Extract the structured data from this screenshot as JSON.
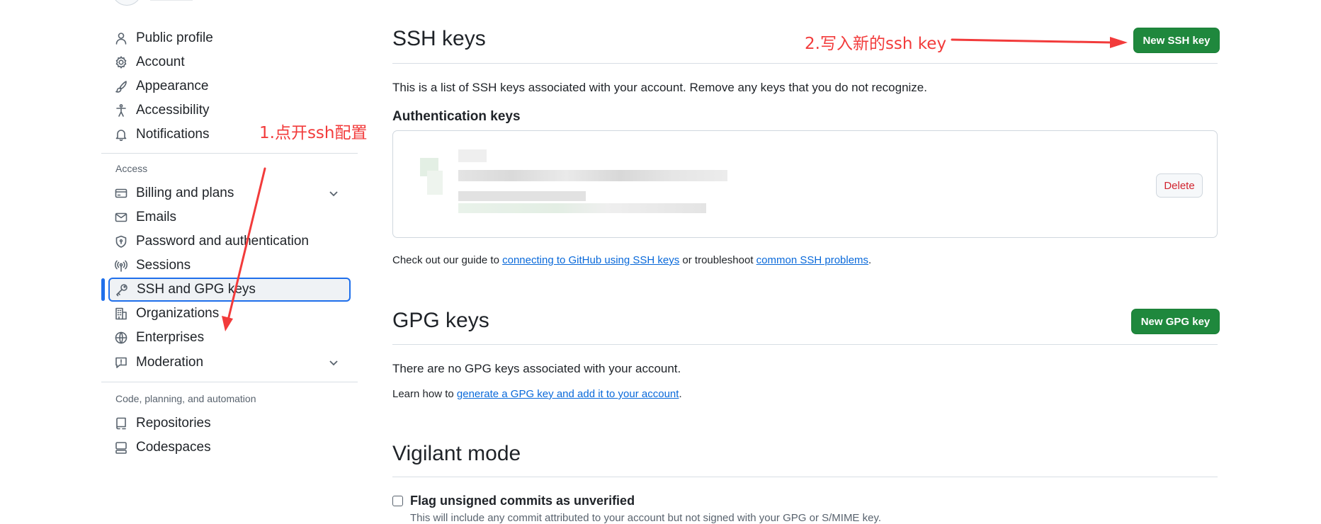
{
  "sidebar": {
    "items_top": [
      {
        "label": "Public profile",
        "icon": "person-icon"
      },
      {
        "label": "Account",
        "icon": "gear-icon"
      },
      {
        "label": "Appearance",
        "icon": "paintbrush-icon"
      },
      {
        "label": "Accessibility",
        "icon": "accessibility-icon"
      },
      {
        "label": "Notifications",
        "icon": "bell-icon"
      }
    ],
    "access_title": "Access",
    "items_access": [
      {
        "label": "Billing and plans",
        "icon": "credit-card-icon"
      },
      {
        "label": "Emails",
        "icon": "mail-icon"
      },
      {
        "label": "Password and authentication",
        "icon": "shield-lock-icon"
      },
      {
        "label": "Sessions",
        "icon": "broadcast-icon"
      },
      {
        "label": "SSH and GPG keys",
        "icon": "key-icon"
      },
      {
        "label": "Organizations",
        "icon": "organization-icon"
      },
      {
        "label": "Enterprises",
        "icon": "globe-icon"
      },
      {
        "label": "Moderation",
        "icon": "report-icon"
      }
    ],
    "code_title": "Code, planning, and automation",
    "items_code": [
      {
        "label": "Repositories",
        "icon": "repo-icon"
      },
      {
        "label": "Codespaces",
        "icon": "codespaces-icon"
      }
    ]
  },
  "ssh": {
    "title": "SSH keys",
    "new_button": "New SSH key",
    "description": "This is a list of SSH keys associated with your account. Remove any keys that you do not recognize.",
    "auth_title": "Authentication keys",
    "delete_button": "Delete",
    "guide_prefix": "Check out our guide to ",
    "guide_link1": "connecting to GitHub using SSH keys",
    "guide_mid": " or troubleshoot ",
    "guide_link2": "common SSH problems",
    "guide_suffix": "."
  },
  "gpg": {
    "title": "GPG keys",
    "new_button": "New GPG key",
    "empty_text": "There are no GPG keys associated with your account.",
    "learn_prefix": "Learn how to ",
    "learn_link": "generate a GPG key and add it to your account",
    "learn_suffix": "."
  },
  "vigilant": {
    "title": "Vigilant mode",
    "checkbox_label": "Flag unsigned commits as unverified",
    "checkbox_checked": false,
    "help_text": "This will include any commit attributed to your account but not signed with your GPG or S/MIME key."
  },
  "annotations": {
    "step1": "1.点开ssh配置",
    "step2": "2.写入新的ssh key"
  },
  "colors": {
    "accent_blue": "#1f6feb",
    "primary_green": "#1f883d",
    "danger_red": "#d1242f",
    "annotation_red": "#f23b3b",
    "link_blue": "#0969da"
  }
}
